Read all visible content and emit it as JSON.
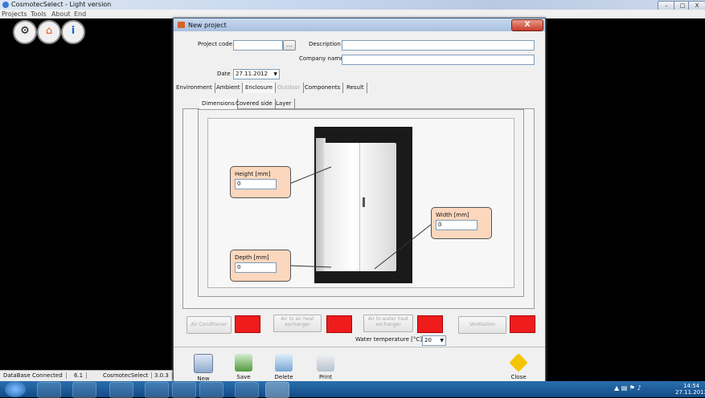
{
  "app": {
    "title": "CosmotecSelect - Light version",
    "menu": [
      "Projects",
      "Tools",
      "About",
      "End"
    ],
    "window_controls": [
      "–",
      "□",
      "X"
    ],
    "status": [
      "DataBase Connected",
      "6.1",
      "CosmotecSelect",
      "3.0.3"
    ]
  },
  "dialog": {
    "title": "New project",
    "close_glyph": "X",
    "project_code_label": "Project code",
    "project_code_value": "",
    "browse_label": "...",
    "description_label": "Description",
    "description_value": "",
    "company_label": "Company name",
    "company_value": "",
    "date_label": "Date",
    "date_value": "27.11.2012",
    "tabs": [
      "Environment",
      "Ambient",
      "Enclosure",
      "Outdoor",
      "Components",
      "Result"
    ],
    "subtabs": [
      "Dimensions",
      "Covered side",
      "Layer"
    ],
    "height_label": "Height [mm]",
    "height_value": "0",
    "width_label": "Width [mm]",
    "width_value": "0",
    "depth_label": "Depth [mm]",
    "depth_value": "0",
    "ventilation_buttons": [
      "Air Conditioner",
      "Air to air heat exchanger",
      "Air to water heat exchanger",
      "Ventilation"
    ],
    "water_temp_label": "Water temperature [°C]",
    "water_temp_value": "20",
    "actions": [
      "New",
      "Save",
      "Delete",
      "Print"
    ],
    "close_label": "Close"
  },
  "taskbar": {
    "time": "14:54",
    "date": "27.11.2012"
  },
  "colors": {
    "callout_bg": "#fbd7bd",
    "status_swatch": "#ee1c1c",
    "taskbar": "#1c5a98"
  }
}
